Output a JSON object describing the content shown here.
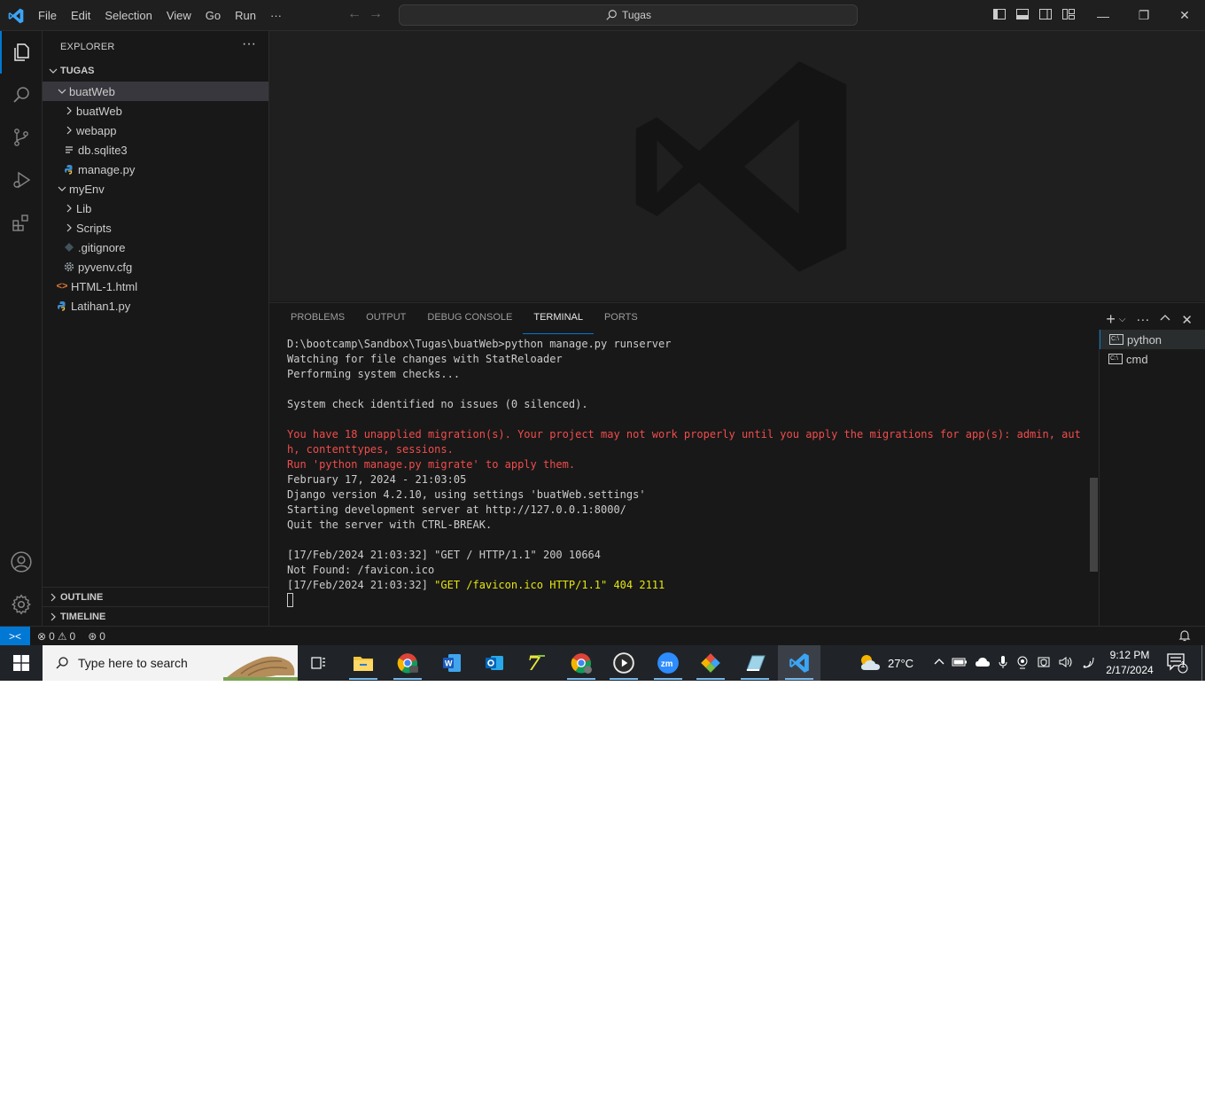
{
  "menu": [
    "File",
    "Edit",
    "Selection",
    "View",
    "Go",
    "Run",
    "···"
  ],
  "command_center": "Tugas",
  "sidebar": {
    "title": "EXPLORER",
    "more": "···",
    "workspace": "TUGAS",
    "tree": [
      {
        "label": "buatWeb",
        "type": "folder-open",
        "depth": 1
      },
      {
        "label": "buatWeb",
        "type": "folder",
        "depth": 2
      },
      {
        "label": "webapp",
        "type": "folder",
        "depth": 2
      },
      {
        "label": "db.sqlite3",
        "type": "file-db",
        "depth": 2
      },
      {
        "label": "manage.py",
        "type": "file-python",
        "depth": 2
      },
      {
        "label": "myEnv",
        "type": "folder-open",
        "depth": 1
      },
      {
        "label": "Lib",
        "type": "folder",
        "depth": 2
      },
      {
        "label": "Scripts",
        "type": "folder",
        "depth": 2
      },
      {
        "label": ".gitignore",
        "type": "file-git",
        "depth": 2
      },
      {
        "label": "pyvenv.cfg",
        "type": "file-gear",
        "depth": 2
      },
      {
        "label": "HTML-1.html",
        "type": "file-html",
        "depth": 1
      },
      {
        "label": "Latihan1.py",
        "type": "file-python",
        "depth": 1
      }
    ],
    "outline": "OUTLINE",
    "timeline": "TIMELINE"
  },
  "panel": {
    "tabs": [
      "PROBLEMS",
      "OUTPUT",
      "DEBUG CONSOLE",
      "TERMINAL",
      "PORTS"
    ],
    "active_tab": "TERMINAL",
    "terminal_lines": [
      {
        "text": "D:\\bootcamp\\Sandbox\\Tugas\\buatWeb>python manage.py runserver",
        "style": "normal"
      },
      {
        "text": "Watching for file changes with StatReloader",
        "style": "normal"
      },
      {
        "text": "Performing system checks...",
        "style": "normal"
      },
      {
        "text": "",
        "style": "normal"
      },
      {
        "text": "System check identified no issues (0 silenced).",
        "style": "normal"
      },
      {
        "text": "",
        "style": "normal"
      },
      {
        "text": "You have 18 unapplied migration(s). Your project may not work properly until you apply the migrations for app(s): admin, auth, contenttypes, sessions.",
        "style": "red"
      },
      {
        "text": "Run 'python manage.py migrate' to apply them.",
        "style": "red"
      },
      {
        "text": "February 17, 2024 - 21:03:05",
        "style": "normal"
      },
      {
        "text": "Django version 4.2.10, using settings 'buatWeb.settings'",
        "style": "normal"
      },
      {
        "text": "Starting development server at http://127.0.0.1:8000/",
        "style": "normal"
      },
      {
        "text": "Quit the server with CTRL-BREAK.",
        "style": "normal"
      },
      {
        "text": "",
        "style": "normal"
      },
      {
        "text": "[17/Feb/2024 21:03:32] \"GET / HTTP/1.1\" 200 10664",
        "style": "normal"
      },
      {
        "text": "Not Found: /favicon.ico",
        "style": "normal"
      }
    ],
    "last_line_prefix": "[17/Feb/2024 21:03:32] ",
    "last_line_highlight": "\"GET /favicon.ico HTTP/1.1\" 404 2111",
    "terminals": [
      "python",
      "cmd"
    ],
    "active_terminal": "python"
  },
  "statusbar": {
    "errors": "0",
    "warnings": "0",
    "ports": "0"
  },
  "taskbar": {
    "search_placeholder": "Type here to search",
    "weather": "27°C",
    "time": "9:12 PM",
    "date": "2/17/2024",
    "notification_count": "1"
  },
  "colors": {
    "accent": "#0078d4",
    "terminal_red": "#f14c4c",
    "terminal_yellow": "#e5e510"
  }
}
